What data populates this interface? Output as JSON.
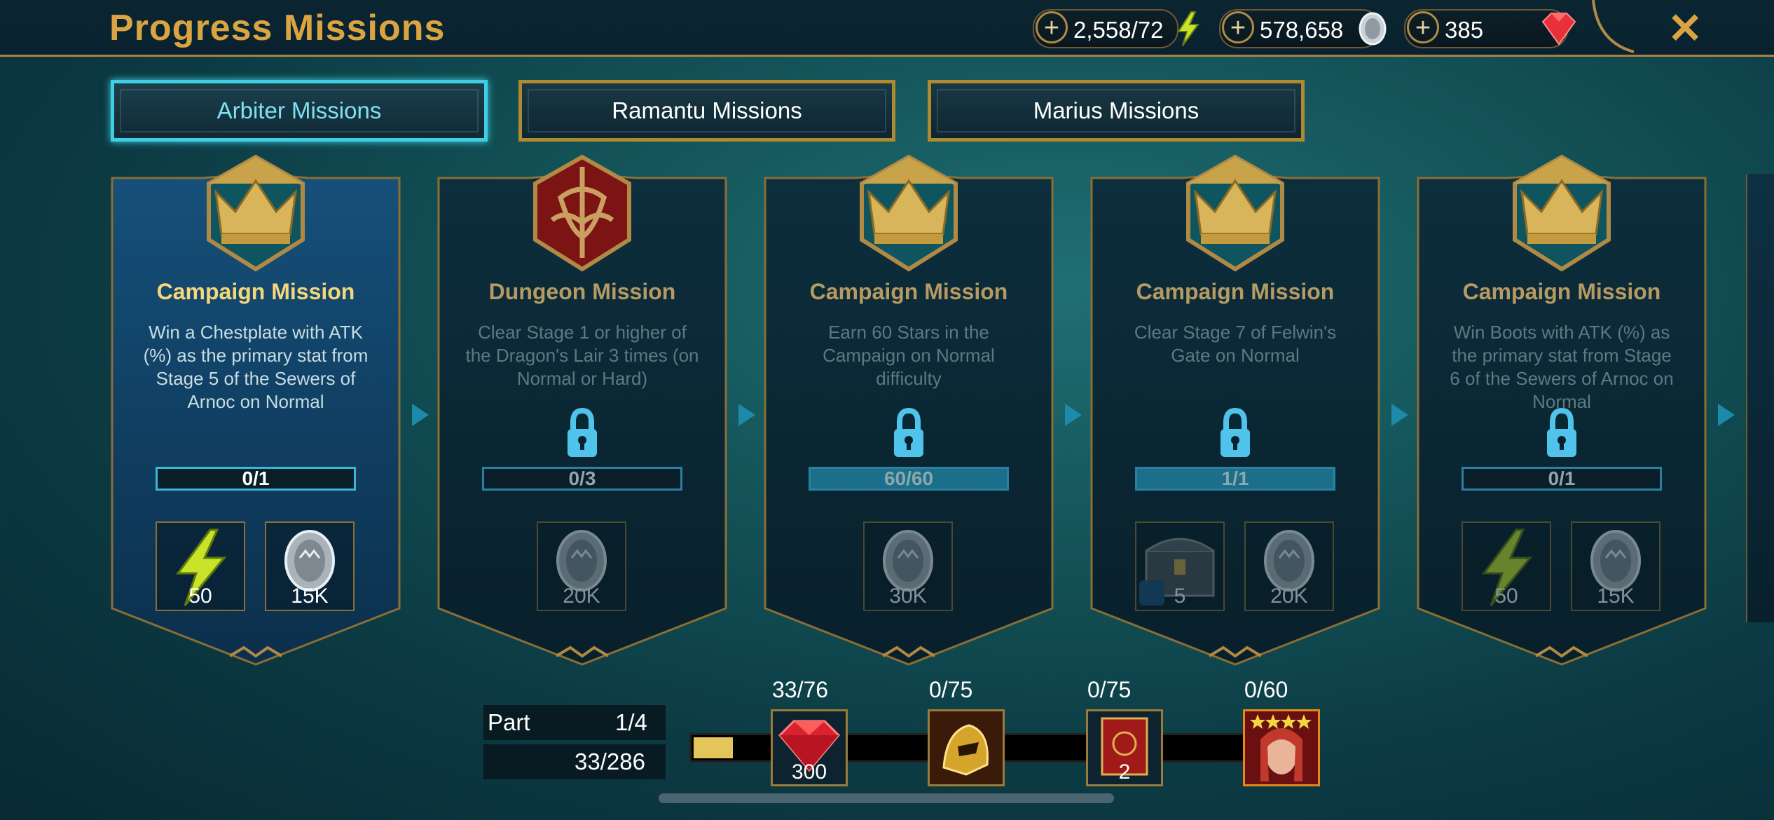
{
  "header": {
    "title": "Progress Missions",
    "energy": "2,558/72",
    "silver": "578,658",
    "gems": "385",
    "close_icon": "close-icon"
  },
  "tabs": [
    {
      "label": "Arbiter Missions",
      "active": true
    },
    {
      "label": "Ramantu Missions",
      "active": false
    },
    {
      "label": "Marius Missions",
      "active": false
    }
  ],
  "missions": [
    {
      "title": "Campaign Mission",
      "desc": "Win a Chestplate with ATK (%) as the primary stat from Stage 5 of the Sewers of Arnoc on Normal",
      "progress": "0/1",
      "progress_fraction": 0,
      "locked": false,
      "icon": "crown-emblem-icon",
      "rewards": [
        {
          "icon": "energy-icon",
          "amount": "50"
        },
        {
          "icon": "silver-coin-icon",
          "amount": "15K"
        }
      ]
    },
    {
      "title": "Dungeon Mission",
      "desc": "Clear Stage 1 or higher of the Dragon's Lair 3 times (on Normal or Hard)",
      "progress": "0/3",
      "progress_fraction": 0,
      "locked": true,
      "icon": "dragon-emblem-icon",
      "rewards": [
        {
          "icon": "silver-coin-icon",
          "amount": "20K"
        }
      ]
    },
    {
      "title": "Campaign Mission",
      "desc": "Earn 60 Stars in the Campaign on Normal difficulty",
      "progress": "60/60",
      "progress_fraction": 1,
      "locked": true,
      "icon": "crown-emblem-icon",
      "rewards": [
        {
          "icon": "silver-coin-icon",
          "amount": "30K"
        }
      ]
    },
    {
      "title": "Campaign Mission",
      "desc": "Clear Stage 7 of Felwin's Gate on Normal",
      "progress": "1/1",
      "progress_fraction": 1,
      "locked": true,
      "icon": "crown-emblem-icon",
      "rewards": [
        {
          "icon": "chest-icon",
          "amount": "5"
        },
        {
          "icon": "silver-coin-icon",
          "amount": "20K"
        }
      ]
    },
    {
      "title": "Campaign Mission",
      "desc": "Win Boots with ATK (%) as the primary stat from Stage 6 of the Sewers of Arnoc on Normal",
      "progress": "0/1",
      "progress_fraction": 0,
      "locked": true,
      "icon": "crown-emblem-icon",
      "rewards": [
        {
          "icon": "energy-icon",
          "amount": "50"
        },
        {
          "icon": "silver-coin-icon",
          "amount": "15K"
        }
      ]
    }
  ],
  "part": {
    "label": "Part",
    "value": "1/4",
    "total": "33/286",
    "fill_fraction": 0.07
  },
  "milestones": [
    {
      "count": "33/76",
      "icon": "ruby-gem-icon",
      "amount": "300"
    },
    {
      "count": "0/75",
      "icon": "golden-helmet-icon",
      "amount": ""
    },
    {
      "count": "0/75",
      "icon": "red-tome-icon",
      "amount": "2"
    },
    {
      "count": "0/60",
      "icon": "champion-portrait-icon",
      "amount": ""
    }
  ],
  "colors": {
    "gold": "#d9a441",
    "cyan": "#3fcfe3",
    "accent_bar": "#e3c55a"
  }
}
